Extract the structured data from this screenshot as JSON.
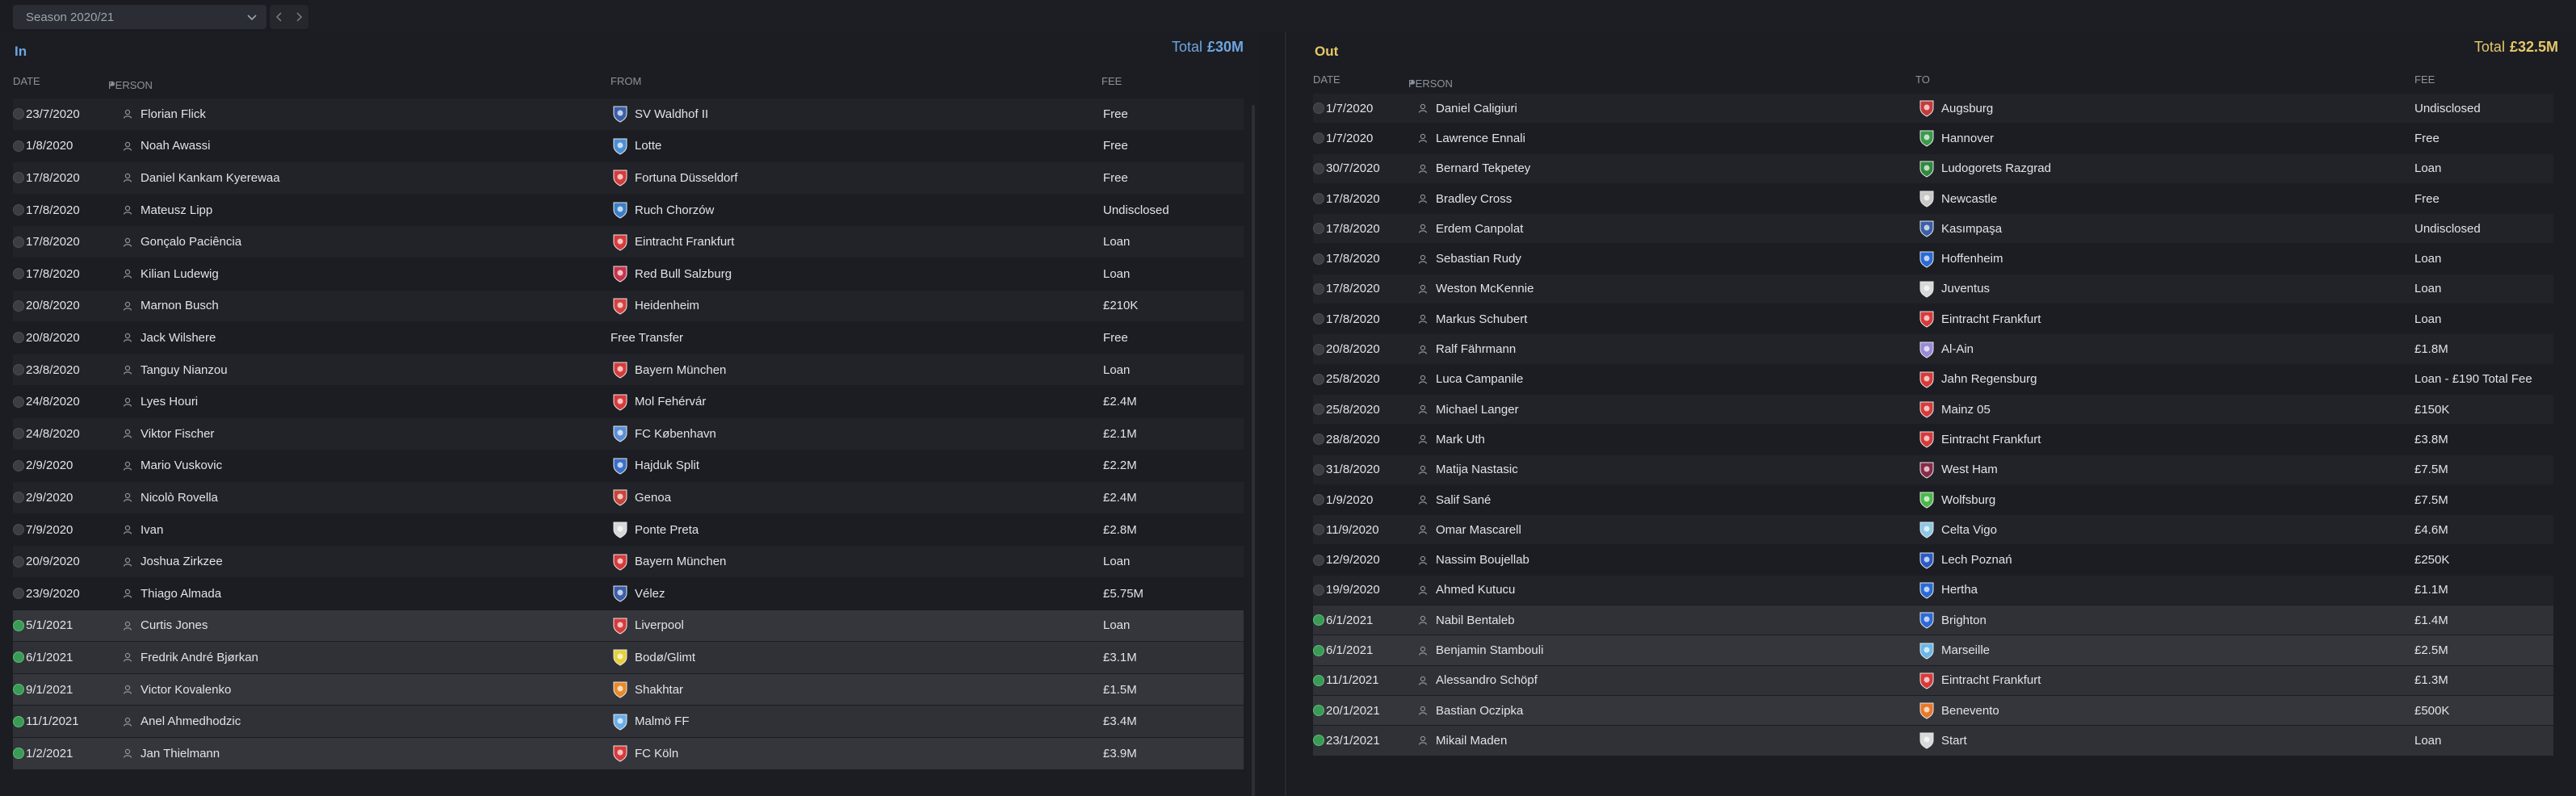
{
  "filter": {
    "season_label": "Season 2020/21",
    "prev_icon": "chevron-left-icon",
    "next_icon": "chevron-right-icon"
  },
  "in_panel": {
    "title": "In",
    "total_label": "Total",
    "total_value": "£30M",
    "headers": {
      "date": "DATE",
      "person": "PERSON",
      "club": "FROM",
      "fee": "FEE"
    },
    "rows": [
      {
        "date": "23/7/2020",
        "person": "Florian Flick",
        "club": "SV Waldhof II",
        "fee": "Free",
        "confirmed": false,
        "crest_color": "#3a5fa8"
      },
      {
        "date": "1/8/2020",
        "person": "Noah Awassi",
        "club": "Lotte",
        "fee": "Free",
        "confirmed": false,
        "crest_color": "#4a8fd6"
      },
      {
        "date": "17/8/2020",
        "person": "Daniel Kankam Kyerewaa",
        "club": "Fortuna Düsseldorf",
        "fee": "Free",
        "confirmed": false,
        "crest_color": "#d83a3a"
      },
      {
        "date": "17/8/2020",
        "person": "Mateusz Lipp",
        "club": "Ruch Chorzów",
        "fee": "Undisclosed",
        "confirmed": false,
        "crest_color": "#3a7fc8"
      },
      {
        "date": "17/8/2020",
        "person": "Gonçalo Paciência",
        "club": "Eintracht Frankfurt",
        "fee": "Loan",
        "confirmed": false,
        "crest_color": "#d83a3a"
      },
      {
        "date": "17/8/2020",
        "person": "Kilian Ludewig",
        "club": "Red Bull Salzburg",
        "fee": "Loan",
        "confirmed": false,
        "crest_color": "#c8334a"
      },
      {
        "date": "20/8/2020",
        "person": "Marnon Busch",
        "club": "Heidenheim",
        "fee": "£210K",
        "confirmed": false,
        "crest_color": "#d84040"
      },
      {
        "date": "20/8/2020",
        "person": "Jack Wilshere",
        "club": "Free Transfer",
        "fee": "Free",
        "confirmed": false,
        "crest_color": ""
      },
      {
        "date": "23/8/2020",
        "person": "Tanguy Nianzou",
        "club": "Bayern München",
        "fee": "Loan",
        "confirmed": false,
        "crest_color": "#d83a3a"
      },
      {
        "date": "24/8/2020",
        "person": "Lyes Houri",
        "club": "Mol Fehérvár",
        "fee": "£2.4M",
        "confirmed": false,
        "crest_color": "#d83a3a"
      },
      {
        "date": "24/8/2020",
        "person": "Viktor Fischer",
        "club": "FC København",
        "fee": "£2.1M",
        "confirmed": false,
        "crest_color": "#5a8fd8"
      },
      {
        "date": "2/9/2020",
        "person": "Mario Vuskovic",
        "club": "Hajduk Split",
        "fee": "£2.2M",
        "confirmed": false,
        "crest_color": "#3a6fc8"
      },
      {
        "date": "2/9/2020",
        "person": "Nicolò Rovella",
        "club": "Genoa",
        "fee": "£2.4M",
        "confirmed": false,
        "crest_color": "#c8443a"
      },
      {
        "date": "7/9/2020",
        "person": "Ivan",
        "club": "Ponte Preta",
        "fee": "£2.8M",
        "confirmed": false,
        "crest_color": "#d8d8d8"
      },
      {
        "date": "20/9/2020",
        "person": "Joshua Zirkzee",
        "club": "Bayern München",
        "fee": "Loan",
        "confirmed": false,
        "crest_color": "#d83a3a"
      },
      {
        "date": "23/9/2020",
        "person": "Thiago Almada",
        "club": "Vélez",
        "fee": "£5.75M",
        "confirmed": false,
        "crest_color": "#3a5fa8"
      },
      {
        "date": "5/1/2021",
        "person": "Curtis Jones",
        "club": "Liverpool",
        "fee": "Loan",
        "confirmed": true,
        "crest_color": "#d83a3a"
      },
      {
        "date": "6/1/2021",
        "person": "Fredrik André Bjørkan",
        "club": "Bodø/Glimt",
        "fee": "£3.1M",
        "confirmed": true,
        "crest_color": "#e8d03a"
      },
      {
        "date": "9/1/2021",
        "person": "Victor Kovalenko",
        "club": "Shakhtar",
        "fee": "£1.5M",
        "confirmed": true,
        "crest_color": "#e88a2a"
      },
      {
        "date": "11/1/2021",
        "person": "Anel Ahmedhodzic",
        "club": "Malmö FF",
        "fee": "£3.4M",
        "confirmed": true,
        "crest_color": "#6aaee8"
      },
      {
        "date": "1/2/2021",
        "person": "Jan Thielmann",
        "club": "FC Köln",
        "fee": "£3.9M",
        "confirmed": true,
        "crest_color": "#d83a3a"
      }
    ]
  },
  "out_panel": {
    "title": "Out",
    "total_label": "Total",
    "total_value": "£32.5M",
    "headers": {
      "date": "DATE",
      "person": "PERSON",
      "club": "TO",
      "fee": "FEE"
    },
    "rows": [
      {
        "date": "1/7/2020",
        "person": "Daniel Caligiuri",
        "club": "Augsburg",
        "fee": "Undisclosed",
        "confirmed": false,
        "crest_color": "#c83a3a"
      },
      {
        "date": "1/7/2020",
        "person": "Lawrence Ennali",
        "club": "Hannover",
        "fee": "Free",
        "confirmed": false,
        "crest_color": "#3a9a4a"
      },
      {
        "date": "30/7/2020",
        "person": "Bernard Tekpetey",
        "club": "Ludogorets Razgrad",
        "fee": "Loan",
        "confirmed": false,
        "crest_color": "#2e8a3e"
      },
      {
        "date": "17/8/2020",
        "person": "Bradley Cross",
        "club": "Newcastle",
        "fee": "Free",
        "confirmed": false,
        "crest_color": "#c8c8c8"
      },
      {
        "date": "17/8/2020",
        "person": "Erdem Canpolat",
        "club": "Kasımpaşa",
        "fee": "Undisclosed",
        "confirmed": false,
        "crest_color": "#3a5fa8"
      },
      {
        "date": "17/8/2020",
        "person": "Sebastian Rudy",
        "club": "Hoffenheim",
        "fee": "Loan",
        "confirmed": false,
        "crest_color": "#2a6ad8"
      },
      {
        "date": "17/8/2020",
        "person": "Weston McKennie",
        "club": "Juventus",
        "fee": "Loan",
        "confirmed": false,
        "crest_color": "#d8d8d8"
      },
      {
        "date": "17/8/2020",
        "person": "Markus Schubert",
        "club": "Eintracht Frankfurt",
        "fee": "Loan",
        "confirmed": false,
        "crest_color": "#d83a3a"
      },
      {
        "date": "20/8/2020",
        "person": "Ralf Fährmann",
        "club": "Al-Ain",
        "fee": "£1.8M",
        "confirmed": false,
        "crest_color": "#9a8ad8"
      },
      {
        "date": "25/8/2020",
        "person": "Luca Campanile",
        "club": "Jahn Regensburg",
        "fee": "Loan - £190 Total Fee",
        "confirmed": false,
        "crest_color": "#d83a3a"
      },
      {
        "date": "25/8/2020",
        "person": "Michael Langer",
        "club": "Mainz 05",
        "fee": "£150K",
        "confirmed": false,
        "crest_color": "#d83a3a"
      },
      {
        "date": "28/8/2020",
        "person": "Mark Uth",
        "club": "Eintracht Frankfurt",
        "fee": "£3.8M",
        "confirmed": false,
        "crest_color": "#d83a3a"
      },
      {
        "date": "31/8/2020",
        "person": "Matija Nastasic",
        "club": "West Ham",
        "fee": "£7.5M",
        "confirmed": false,
        "crest_color": "#8a2a4a"
      },
      {
        "date": "1/9/2020",
        "person": "Salif Sané",
        "club": "Wolfsburg",
        "fee": "£7.5M",
        "confirmed": false,
        "crest_color": "#4ab84a"
      },
      {
        "date": "11/9/2020",
        "person": "Omar Mascarell",
        "club": "Celta Vigo",
        "fee": "£4.6M",
        "confirmed": false,
        "crest_color": "#8ac8e8"
      },
      {
        "date": "12/9/2020",
        "person": "Nassim Boujellab",
        "club": "Lech Poznań",
        "fee": "£250K",
        "confirmed": false,
        "crest_color": "#2a5ac8"
      },
      {
        "date": "19/9/2020",
        "person": "Ahmed Kutucu",
        "club": "Hertha",
        "fee": "£1.1M",
        "confirmed": false,
        "crest_color": "#2a6ad8"
      },
      {
        "date": "6/1/2021",
        "person": "Nabil Bentaleb",
        "club": "Brighton",
        "fee": "£1.4M",
        "confirmed": true,
        "crest_color": "#2a6ad8"
      },
      {
        "date": "6/1/2021",
        "person": "Benjamin Stambouli",
        "club": "Marseille",
        "fee": "£2.5M",
        "confirmed": true,
        "crest_color": "#6ab8e8"
      },
      {
        "date": "11/1/2021",
        "person": "Alessandro Schöpf",
        "club": "Eintracht Frankfurt",
        "fee": "£1.3M",
        "confirmed": true,
        "crest_color": "#d83a3a"
      },
      {
        "date": "20/1/2021",
        "person": "Bastian Oczipka",
        "club": "Benevento",
        "fee": "£500K",
        "confirmed": true,
        "crest_color": "#e8782a"
      },
      {
        "date": "23/1/2021",
        "person": "Mikail Maden",
        "club": "Start",
        "fee": "Loan",
        "confirmed": true,
        "crest_color": "#d8d8d8"
      }
    ]
  },
  "colors": {
    "in_accent": "#6ea6e0",
    "out_accent": "#e6c76a",
    "confirmed": "#3b9a55"
  }
}
